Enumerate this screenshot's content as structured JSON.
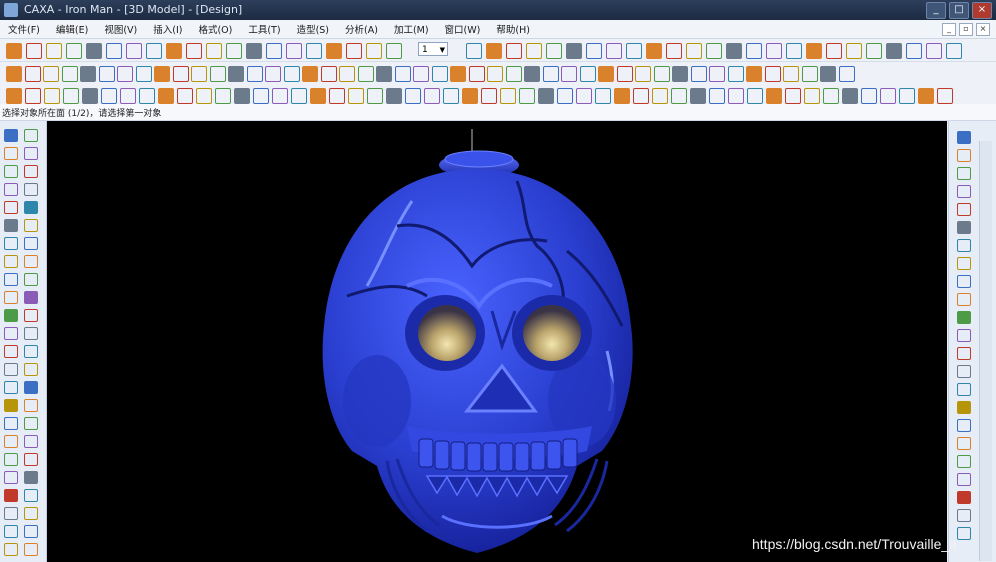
{
  "window": {
    "title": "CAXA - Iron Man - [3D Model] - [Design]"
  },
  "menu": {
    "items": [
      "文件(F)",
      "编辑(E)",
      "视图(V)",
      "插入(I)",
      "格式(O)",
      "工具(T)",
      "造型(S)",
      "分析(A)",
      "加工(M)",
      "窗口(W)",
      "帮助(H)"
    ]
  },
  "toolbar": {
    "zoom_value": "1"
  },
  "prompt": {
    "text": "选择对象所在面 (1/2)，请选择第一对象"
  },
  "viewport": {
    "background_color": "#000000",
    "model_color": "#2a3fd0",
    "model_name": "skull-model"
  },
  "watermark": {
    "text": "https://blog.csdn.net/Trouvaille_a"
  },
  "colors": {
    "titlebar": "#1d2b42",
    "toolbar": "#eef2f8",
    "accent": "#2a3fd0"
  }
}
